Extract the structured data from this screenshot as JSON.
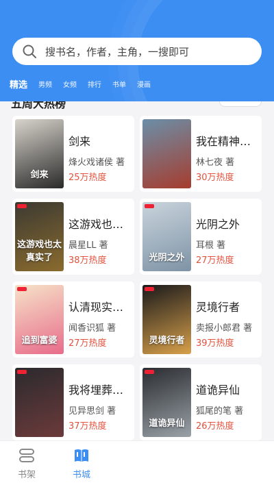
{
  "search": {
    "placeholder": "搜书名，作者，主角，一搜即可"
  },
  "tabs": [
    {
      "label": "精选",
      "active": true
    },
    {
      "label": "男频"
    },
    {
      "label": "女频"
    },
    {
      "label": "排行"
    },
    {
      "label": "书单"
    },
    {
      "label": "漫画"
    }
  ],
  "section": {
    "title": "五周大热榜"
  },
  "books": [
    {
      "title": "剑来",
      "author": "烽火戏诸侯 著",
      "heat": "25万热度",
      "cover_text": "剑来",
      "cover_colors": [
        "#d8d4cc",
        "#2a2a2a"
      ]
    },
    {
      "title": "我在精神…",
      "author": "林七夜 著",
      "heat": "30万热度",
      "cover_text": "",
      "cover_colors": [
        "#6b8fa8",
        "#a63c2e"
      ]
    },
    {
      "title": "这游戏也…",
      "author": "晨星LL 著",
      "heat": "38万热度",
      "cover_text": "这游戏也太真实了",
      "cover_colors": [
        "#3c3a32",
        "#8a6b2e"
      ]
    },
    {
      "title": "光阴之外",
      "author": "耳根 著",
      "heat": "27万热度",
      "cover_text": "光阴之外",
      "cover_colors": [
        "#c9d4dc",
        "#7e93a6"
      ]
    },
    {
      "title": "认清现实…",
      "author": "闻香识狐 著",
      "heat": "27万热度",
      "cover_text": "追到富婆",
      "cover_colors": [
        "#f6e2c8",
        "#e86c8a"
      ]
    },
    {
      "title": "灵境行者",
      "author": "卖报小郎君 著",
      "heat": "39万热度",
      "cover_text": "灵境行者",
      "cover_colors": [
        "#1a1a1c",
        "#d8a04a"
      ]
    },
    {
      "title": "我将埋葬…",
      "author": "见异思剑 著",
      "heat": "37万热度",
      "cover_text": "",
      "cover_colors": [
        "#2b2a2e",
        "#6c3a3a"
      ]
    },
    {
      "title": "道诡异仙",
      "author": "狐尾的笔 著",
      "heat": "26万热度",
      "cover_text": "道诡异仙",
      "cover_colors": [
        "#2a2c30",
        "#9aa2a8"
      ]
    }
  ],
  "bottom_nav": [
    {
      "label": "书架",
      "icon": "bookshelf-icon"
    },
    {
      "label": "书城",
      "icon": "bookstore-icon",
      "active": true
    }
  ],
  "colors": {
    "brand": "#3d8ef3",
    "heat": "#e3503c"
  }
}
